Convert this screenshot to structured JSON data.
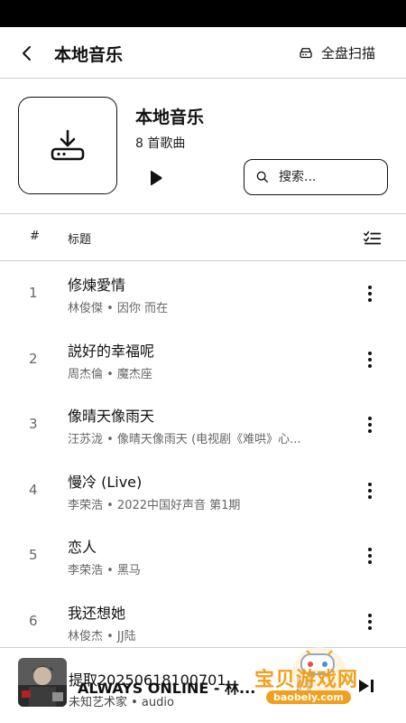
{
  "header": {
    "title": "本地音乐",
    "scan_label": "全盘扫描"
  },
  "album": {
    "title": "本地音乐",
    "count": "8 首歌曲"
  },
  "search": {
    "placeholder": "搜索..."
  },
  "columns": {
    "number": "#",
    "title": "标题"
  },
  "songs": [
    {
      "num": "1",
      "title": "修煉愛情",
      "sub": "林俊傑 • 因你 而在"
    },
    {
      "num": "2",
      "title": "説好的幸福呢",
      "sub": "周杰倫 • 魔杰座"
    },
    {
      "num": "3",
      "title": "像晴天像雨天",
      "sub": "汪苏泷 • 像晴天像雨天 (电视剧《难哄》心..."
    },
    {
      "num": "4",
      "title": "慢冷 (Live)",
      "sub": "李荣浩 • 2022中国好声音 第1期"
    },
    {
      "num": "5",
      "title": "恋人",
      "sub": "李荣浩 • 黑马"
    },
    {
      "num": "6",
      "title": "我还想她",
      "sub": "林俊杰 • JJ陆"
    }
  ],
  "player": {
    "title": "提取20250618100701",
    "overlay_title": "ALWAYS ONLINE - 林...",
    "subtitle": "未知艺术家 • audio"
  },
  "watermark": {
    "text": "宝贝游戏网",
    "url": "baobely.com"
  },
  "colors": {
    "accent": "#111111",
    "watermark": "#f2a01c"
  },
  "icons": [
    "back-arrow-icon",
    "scan-disk-icon",
    "download-drive-icon",
    "play-icon",
    "search-icon",
    "sort-list-icon",
    "more-vertical-icon",
    "skip-next-icon"
  ]
}
